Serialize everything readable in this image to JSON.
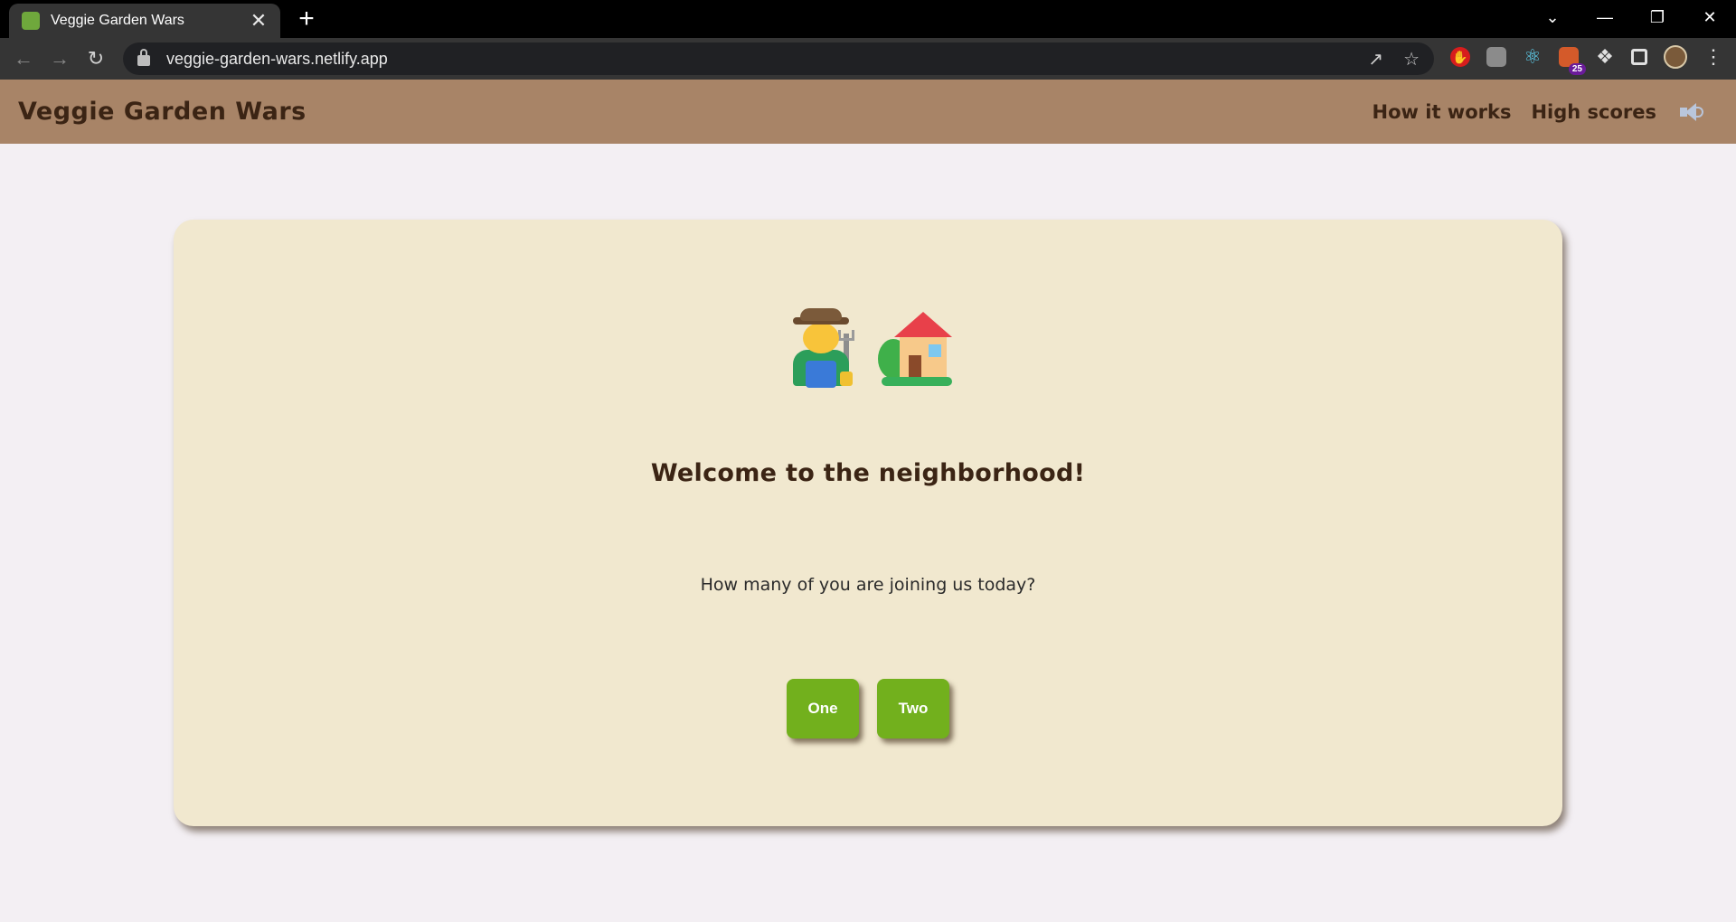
{
  "browser": {
    "tab_title": "Veggie Garden Wars",
    "tab_close": "✕",
    "new_tab": "+",
    "url": "veggie-garden-wars.netlify.app",
    "extension_badge": "25"
  },
  "header": {
    "brand": "Veggie Garden Wars",
    "nav": {
      "how_it_works": "How it works",
      "high_scores": "High scores"
    }
  },
  "card": {
    "emojis": [
      "farmer-icon",
      "house-with-garden-icon"
    ],
    "welcome": "Welcome to the neighborhood!",
    "question": "How many of you are joining us today?",
    "buttons": {
      "one": "One",
      "two": "Two"
    }
  },
  "colors": {
    "header_bg": "#a88467",
    "card_bg": "#f1e8cf",
    "button_green": "#72b01d",
    "brand_brown": "#3b2414",
    "page_bg": "#f3eff3"
  }
}
